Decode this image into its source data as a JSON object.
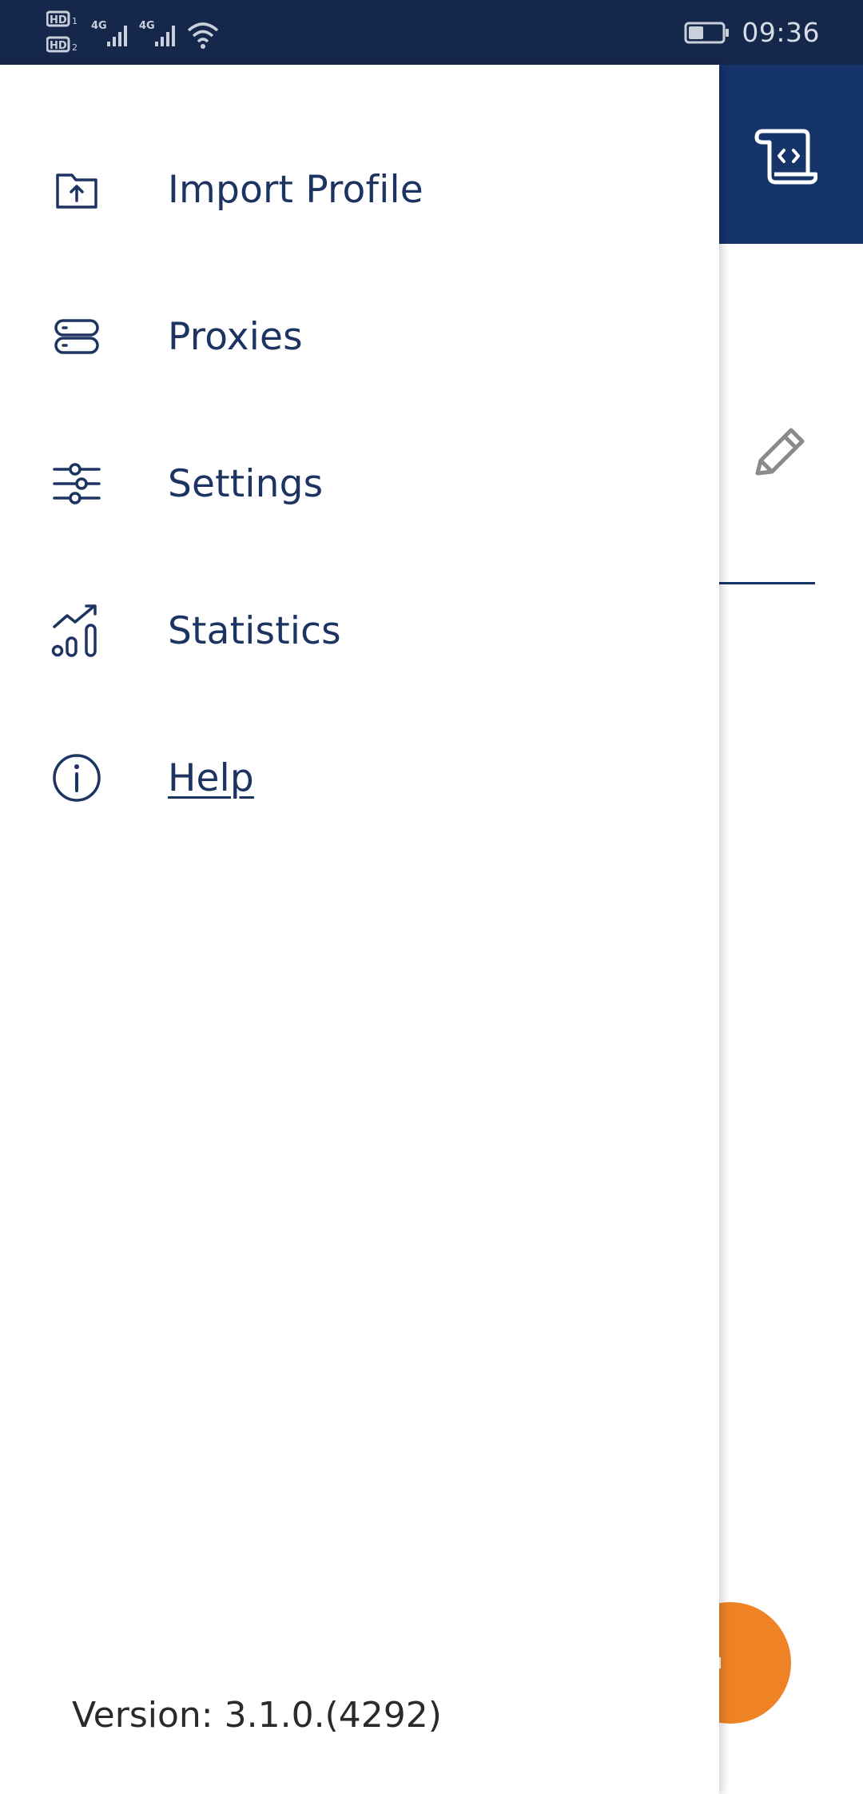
{
  "status_bar": {
    "time": "09:36",
    "sim1_label": "HD",
    "sim2_label": "HD",
    "network1": "4G",
    "network2": "4G",
    "battery_level": 0.45
  },
  "drawer": {
    "items": [
      {
        "label": "Import Profile",
        "icon": "folder-upload-icon"
      },
      {
        "label": "Proxies",
        "icon": "server-icon"
      },
      {
        "label": "Settings",
        "icon": "sliders-icon"
      },
      {
        "label": "Statistics",
        "icon": "chart-growth-icon"
      },
      {
        "label": "Help",
        "icon": "info-icon"
      }
    ],
    "version": "Version: 3.1.0.(4292)"
  },
  "background_app": {
    "header_icon": "code-scroll-icon",
    "edit_icon": "pencil-icon",
    "fab_icon": "plus-icon"
  },
  "colors": {
    "status_bar": "#15274a",
    "header": "#15346a",
    "menu_text": "#1d3462",
    "fab": "#ee8224"
  }
}
